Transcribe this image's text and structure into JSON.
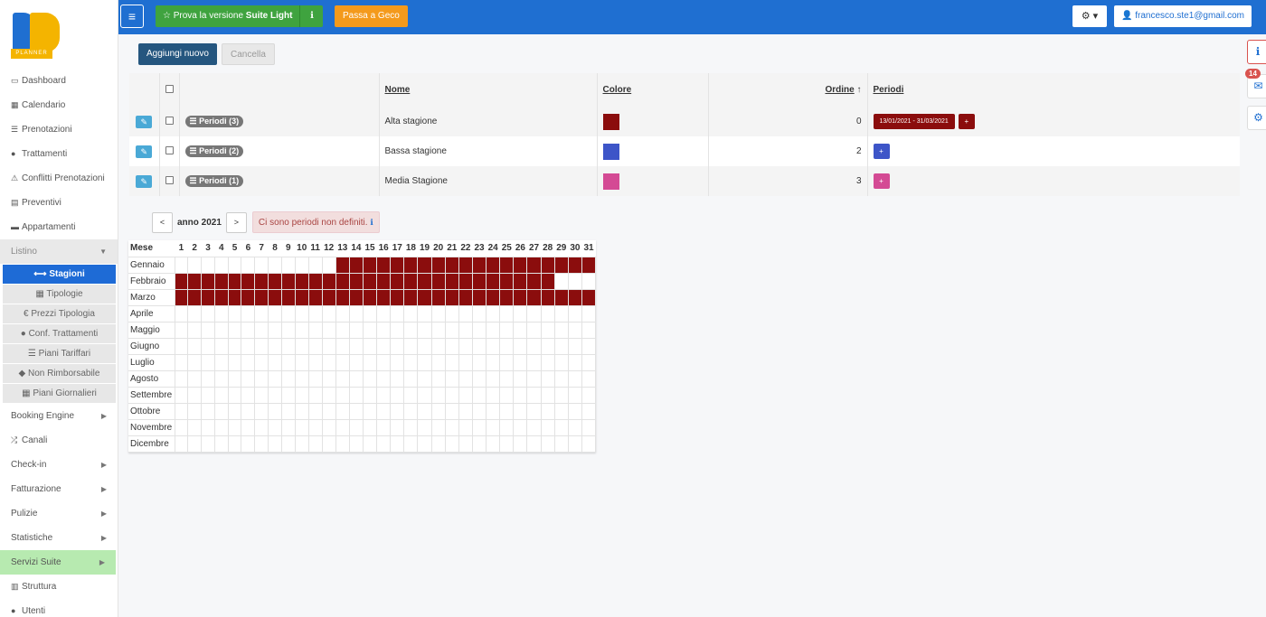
{
  "app": {
    "logo_text": "PLANNER"
  },
  "sidebar": {
    "items": [
      {
        "label": "Dashboard",
        "icon": "monitor-icon"
      },
      {
        "label": "Calendario",
        "icon": "calendar-icon"
      },
      {
        "label": "Prenotazioni",
        "icon": "list-icon"
      },
      {
        "label": "Trattamenti",
        "icon": "apple-icon"
      },
      {
        "label": "Conflitti Prenotazioni",
        "icon": "warning-icon"
      },
      {
        "label": "Preventivi",
        "icon": "document-icon"
      },
      {
        "label": "Appartamenti",
        "icon": "bed-icon"
      }
    ],
    "listino": {
      "label": "Listino",
      "subs": [
        {
          "label": "Stagioni",
          "icon": "arrows-icon",
          "active": true
        },
        {
          "label": "Tipologie",
          "icon": "grid-icon"
        },
        {
          "label": "Prezzi Tipologia",
          "icon": "euro-icon"
        },
        {
          "label": "Conf. Trattamenti",
          "icon": "apple-icon"
        },
        {
          "label": "Piani Tariffari",
          "icon": "list-icon"
        },
        {
          "label": "Non Rimborsabile",
          "icon": "tag-icon"
        },
        {
          "label": "Piani Giornalieri",
          "icon": "grid-icon"
        }
      ]
    },
    "bottom": [
      {
        "label": "Booking Engine",
        "arrow": true
      },
      {
        "label": "Canali",
        "icon": "shuffle-icon"
      },
      {
        "label": "Check-in",
        "arrow": true
      },
      {
        "label": "Fatturazione",
        "arrow": true
      },
      {
        "label": "Pulizie",
        "arrow": true
      },
      {
        "label": "Statistiche",
        "arrow": true
      },
      {
        "label": "Servizi Suite",
        "arrow": true,
        "green": true
      },
      {
        "label": "Struttura",
        "icon": "building-icon"
      },
      {
        "label": "Utenti",
        "icon": "user-icon"
      }
    ]
  },
  "topbar": {
    "suite_prefix": "Prova la versione ",
    "suite_bold": "Suite Light",
    "geco": "Passa a Geco",
    "user": "francesco.ste1@gmail.com"
  },
  "right": {
    "mail_badge": "14"
  },
  "toolbar": {
    "add": "Aggiungi nuovo",
    "delete": "Cancella"
  },
  "table": {
    "headers": {
      "nome": "Nome",
      "colore": "Colore",
      "ordine": "Ordine",
      "periodi": "Periodi"
    },
    "rows": [
      {
        "badge": "Periodi (3)",
        "nome": "Alta stagione",
        "color": "#8b0d0d",
        "ordine": "0",
        "range": "13/01/2021 - 31/03/2021"
      },
      {
        "badge": "Periodi (2)",
        "nome": "Bassa stagione",
        "color": "#3d55c8",
        "ordine": "2",
        "range": ""
      },
      {
        "badge": "Periodi (1)",
        "nome": "Media Stagione",
        "color": "#d44a94",
        "ordine": "3",
        "range": ""
      }
    ]
  },
  "calendar": {
    "prev": "<",
    "next": ">",
    "year_label": "anno 2021",
    "warning": "Ci sono periodi non definiti.",
    "month_header": "Mese",
    "fill_color": "#8b0d0d",
    "months": [
      {
        "name": "Gennaio",
        "days": 31,
        "filled": [
          13,
          31
        ]
      },
      {
        "name": "Febbraio",
        "days": 28,
        "filled": [
          1,
          28
        ]
      },
      {
        "name": "Marzo",
        "days": 31,
        "filled": [
          1,
          31
        ]
      },
      {
        "name": "Aprile",
        "days": 30,
        "filled": []
      },
      {
        "name": "Maggio",
        "days": 31,
        "filled": []
      },
      {
        "name": "Giugno",
        "days": 30,
        "filled": []
      },
      {
        "name": "Luglio",
        "days": 31,
        "filled": []
      },
      {
        "name": "Agosto",
        "days": 31,
        "filled": []
      },
      {
        "name": "Settembre",
        "days": 30,
        "filled": []
      },
      {
        "name": "Ottobre",
        "days": 31,
        "filled": []
      },
      {
        "name": "Novembre",
        "days": 30,
        "filled": []
      },
      {
        "name": "Dicembre",
        "days": 31,
        "filled": []
      }
    ]
  }
}
